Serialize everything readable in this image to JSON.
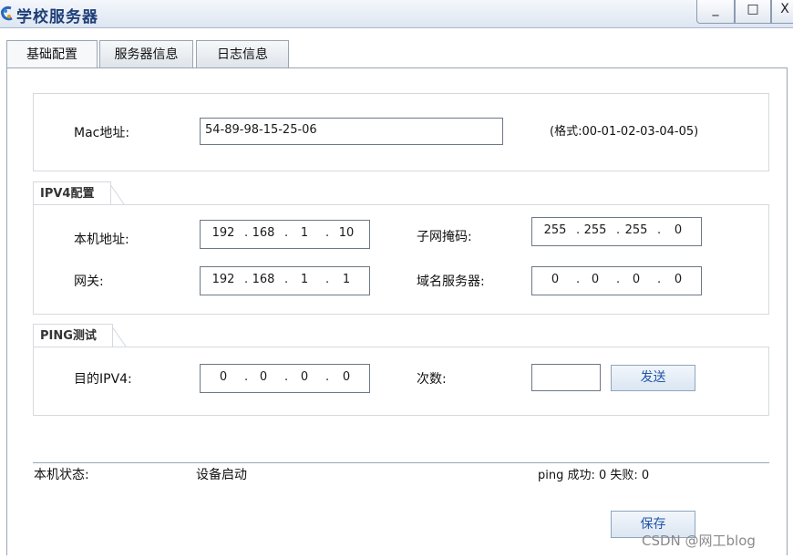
{
  "window": {
    "title": "学校服务器",
    "minimize": "_",
    "maximize": "□",
    "close": "X"
  },
  "tabs": [
    {
      "label": "基础配置",
      "active": true
    },
    {
      "label": "服务器信息",
      "active": false
    },
    {
      "label": "日志信息",
      "active": false
    }
  ],
  "mac": {
    "label": "Mac地址:",
    "value": "54-89-98-15-25-06",
    "format_hint": "(格式:00-01-02-03-04-05)"
  },
  "ipv4": {
    "group_title": "IPV4配置",
    "local_addr_label": "本机地址:",
    "local_addr": [
      "192",
      "168",
      "1",
      "10"
    ],
    "subnet_label": "子网掩码:",
    "subnet": [
      "255",
      "255",
      "255",
      "0"
    ],
    "gateway_label": "网关:",
    "gateway": [
      "192",
      "168",
      "1",
      "1"
    ],
    "dns_label": "域名服务器:",
    "dns": [
      "0",
      "0",
      "0",
      "0"
    ]
  },
  "ping": {
    "group_title": "PING测试",
    "target_label": "目的IPV4:",
    "target": [
      "0",
      "0",
      "0",
      "0"
    ],
    "count_label": "次数:",
    "count_value": "",
    "send_button": "发送"
  },
  "status": {
    "label": "本机状态:",
    "value": "设备启动",
    "ping_result": "ping 成功: 0 失败: 0"
  },
  "save_button": "保存",
  "watermark": "CSDN @网工blog"
}
